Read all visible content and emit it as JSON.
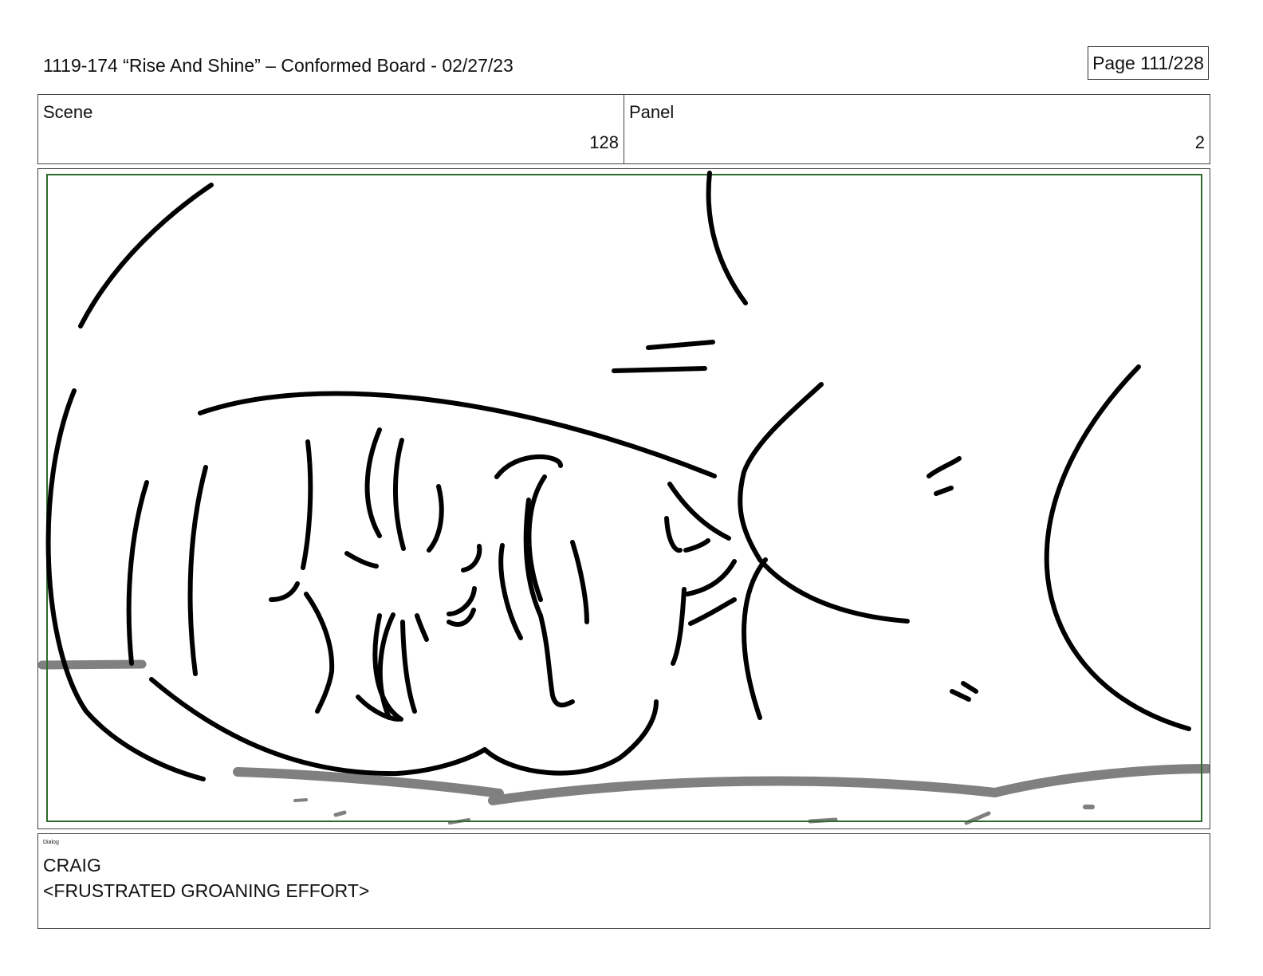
{
  "header": {
    "title": "1119-174 “Rise And Shine” – Conformed Board - 02/27/23",
    "page_label": "Page 111/228"
  },
  "info": {
    "scene_label": "Scene",
    "scene_value": "128",
    "panel_label": "Panel",
    "panel_value": "2"
  },
  "panel": {
    "image": "storyboard-sketch-face-close-up",
    "safe_frame_color": "#2e6b2e",
    "ink_color": "#000000",
    "ground_color": "#808080"
  },
  "dialog": {
    "label": "Dialog",
    "character": "CRAIG",
    "line": "<FRUSTRATED GROANING EFFORT>"
  }
}
